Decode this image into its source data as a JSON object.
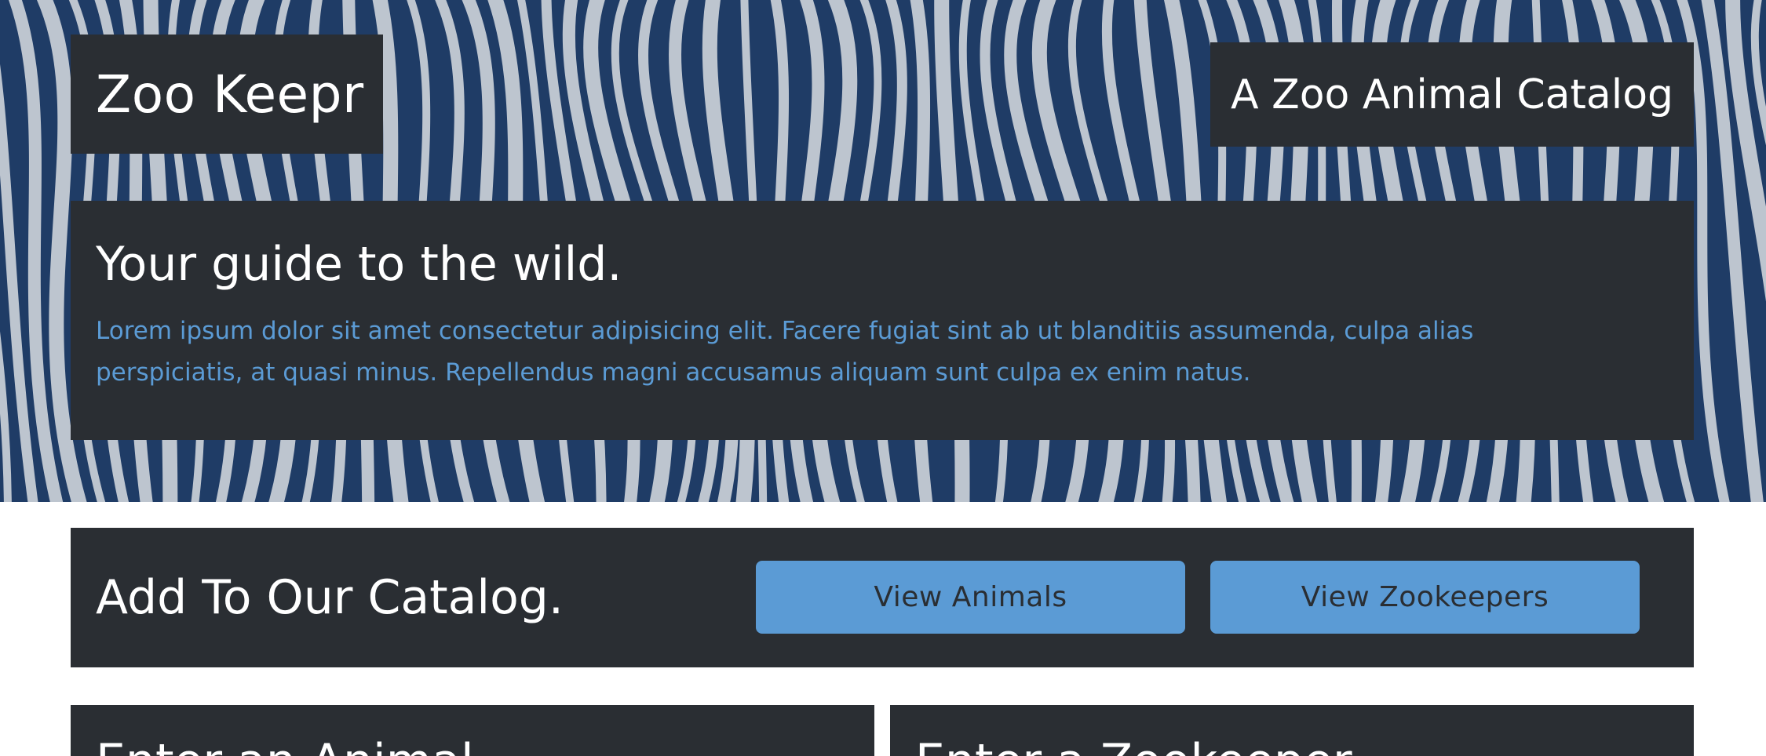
{
  "header": {
    "brand": "Zoo Keepr",
    "tagline": "A Zoo Animal Catalog"
  },
  "intro": {
    "heading": "Your guide to the wild.",
    "body": "Lorem ipsum dolor sit amet consectetur adipisicing elit. Facere fugiat sint ab ut blanditiis assumenda, culpa alias perspiciatis, at quasi minus. Repellendus magni accusamus aliquam sunt culpa ex enim natus."
  },
  "catalog": {
    "heading": "Add To Our Catalog.",
    "view_animals_label": "View Animals",
    "view_zookeepers_label": "View Zookeepers"
  },
  "cards": {
    "left_heading": "Enter an Animal",
    "right_heading": "Enter a Zookeeper"
  },
  "colors": {
    "panel": "#2a2e33",
    "accent": "#5b9bd5",
    "hero_blue": "#1f3c66"
  }
}
